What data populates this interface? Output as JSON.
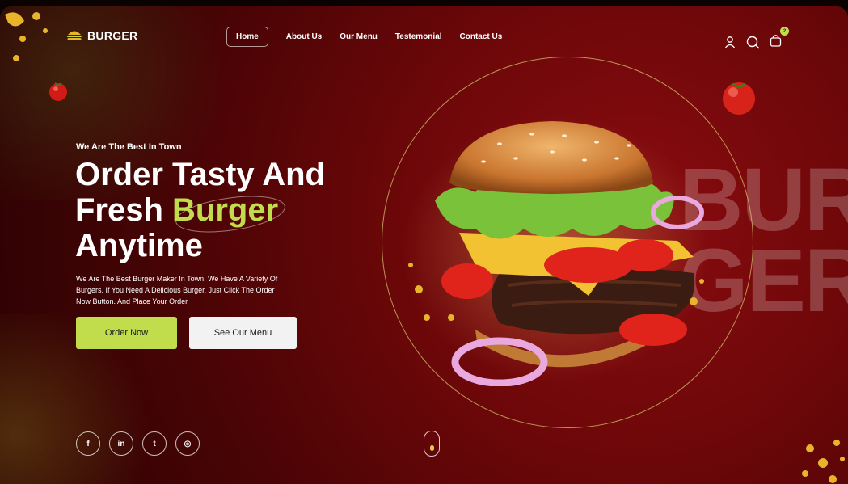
{
  "brand": {
    "name": "BURGER",
    "logo_icon": "burger-icon"
  },
  "nav": {
    "items": [
      "Home",
      "About Us",
      "Our Menu",
      "Testemonial",
      "Contact Us"
    ],
    "active_index": 0
  },
  "header_icons": [
    "user-icon",
    "search-icon",
    "bag-icon"
  ],
  "cart": {
    "count": "2"
  },
  "hero": {
    "tagline": "We Are The Best In Town",
    "headline": {
      "line1": "Order Tasty And",
      "line2_prefix": "Fresh ",
      "line2_accent": "Burger",
      "line3": "Anytime"
    },
    "description": "We Are The Best Burger Maker In Town. We Have A Variety Of Burgers. If You Need A Delicious Burger. Just Click The Order Now Button. And Place Your Order",
    "primary_button": "Order Now",
    "secondary_button": "See Our Menu"
  },
  "socials": [
    {
      "name": "facebook-icon",
      "glyph": "f"
    },
    {
      "name": "linkedin-icon",
      "glyph": "in"
    },
    {
      "name": "twitter-icon",
      "glyph": "t"
    },
    {
      "name": "instagram-icon",
      "glyph": "◎"
    }
  ],
  "background_text": {
    "line1": "BUR",
    "line2": "GER"
  },
  "colors": {
    "accent": "#c2dd4c",
    "background": "#6c0709",
    "ring": "#d6c46e",
    "button_light": "#f2f2f2"
  }
}
